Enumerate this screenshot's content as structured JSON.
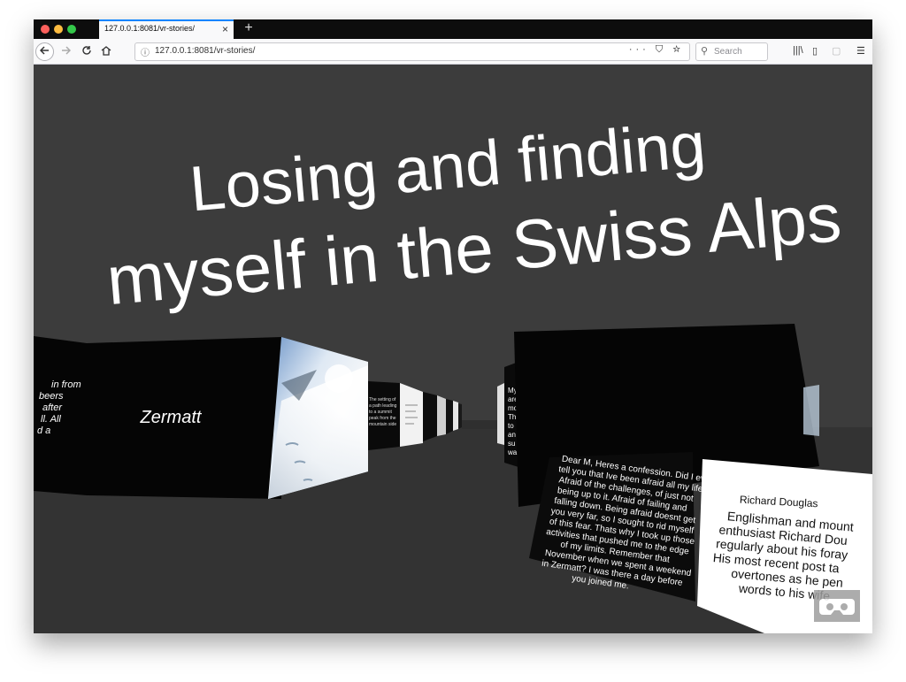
{
  "browser": {
    "tab_title": "127.0.0.1:8081/vr-stories/",
    "tab_close": "×",
    "new_tab": "+",
    "url": "127.0.0.1:8081/vr-stories/",
    "url_actions": "··· ⛉ ☆",
    "search_placeholder": "Search",
    "colors": {
      "close": "#fc605c",
      "minimize": "#fdbc40",
      "maximize": "#34c84a",
      "accent": "#0a84ff"
    }
  },
  "scene": {
    "title_line1": "Losing and finding",
    "title_line2": "myself in the Swiss Alps",
    "left_panel_label": "Zermatt",
    "left_edge_text": [
      "in from",
      "beers",
      "after",
      "ll. All",
      "d a"
    ],
    "letter_text": [
      "Dear M, Heres a confession. Did I ever",
      "tell you that Ive been afraid all my life?",
      "Afraid of the challenges, of just not",
      "being up to it. Afraid of failing and",
      "falling down. Being afraid doesnt get",
      "you very far, so I sought to rid myself",
      "of this fear. Thats why I took up those",
      "activities that pushed me to the edge",
      "of my limits. Remember that",
      "November when we spent a weekend",
      "in Zermatt? I was there a day before",
      "you joined me."
    ],
    "author_name": "Richard Douglas",
    "author_bio": [
      "Englishman and mount",
      "enthusiast Richard Dou",
      "regularly about his foray",
      "His most recent post ta",
      "overtones as he pen",
      "words to his wife"
    ],
    "far_panel_text": [
      "My",
      "are",
      "mo",
      "Th",
      "to",
      "an",
      "su",
      "wa",
      "an"
    ],
    "small_panel_text": [
      "The setting of",
      "a path leading",
      "to a summit",
      "peak from the",
      "mountain side"
    ]
  }
}
